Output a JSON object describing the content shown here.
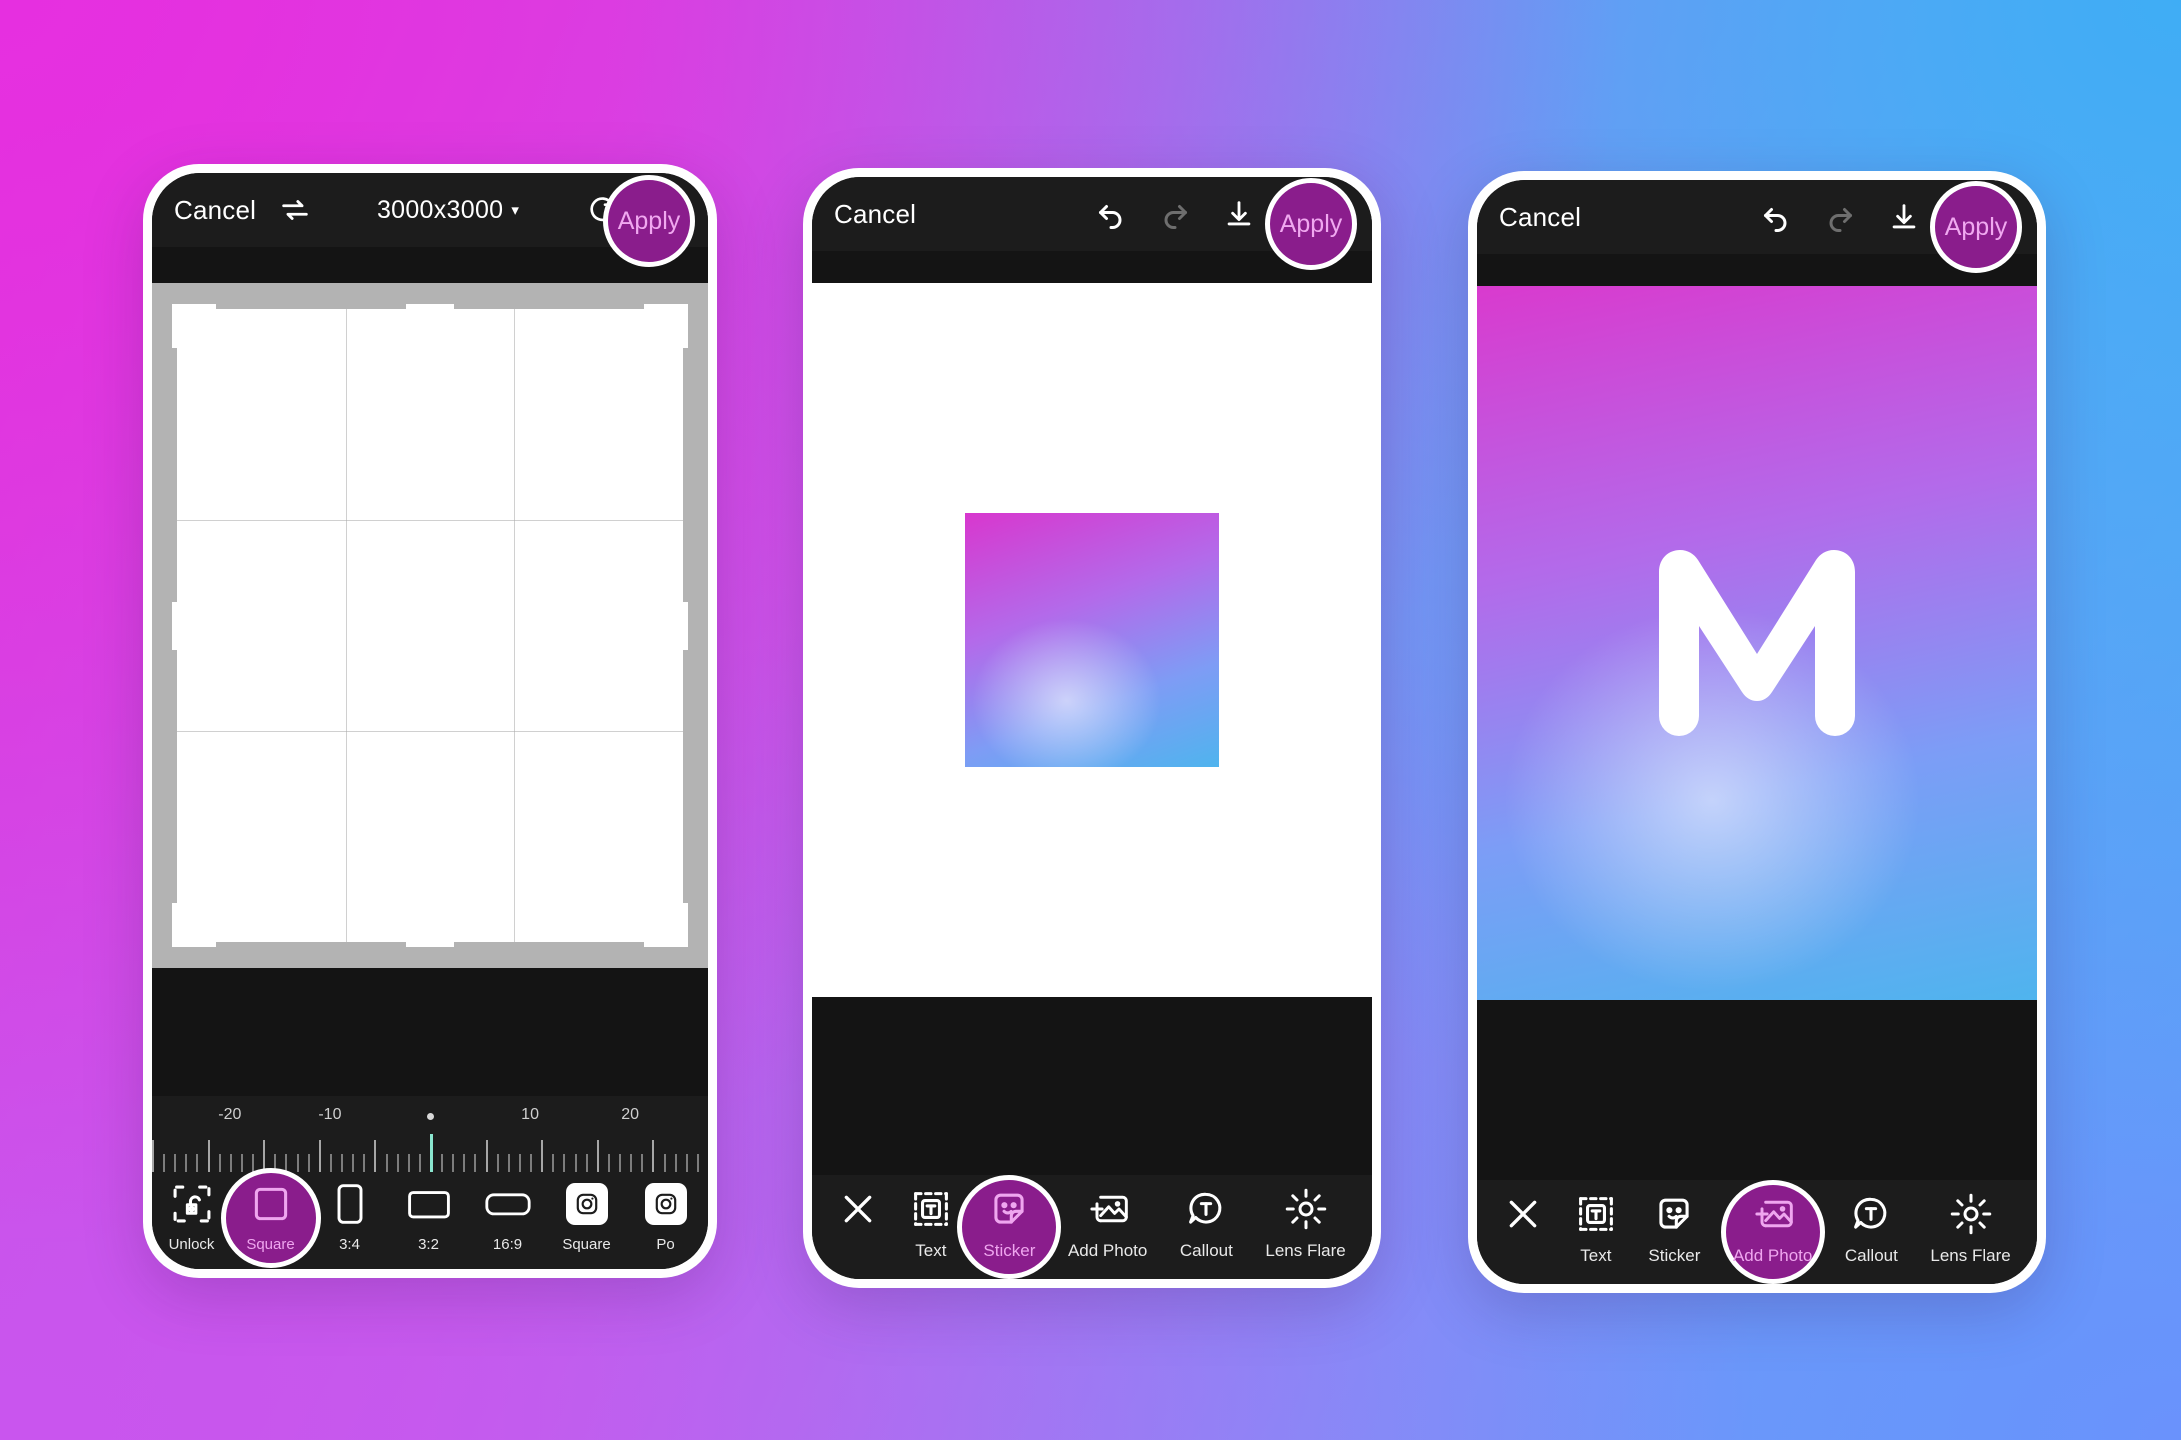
{
  "background": {
    "corner_top_left": "#E62FE0",
    "corner_top_right": "#3FADF5",
    "corner_bottom_left": "#C955EE",
    "corner_bottom_right": "#6A92FC"
  },
  "theme": {
    "accent_magenta": "#8A1D8C",
    "accent_text_pink": "#EFA6EF",
    "bar_dark": "#1C1C1C",
    "canvas_dark": "#141414",
    "needle_teal": "#8AE6CF"
  },
  "phones": [
    {
      "id": "crop-screen",
      "topbar": {
        "cancel_label": "Cancel",
        "flip_icon": "flip-swap-icon",
        "size_label": "3000x3000",
        "size_caret": "▾",
        "rotate_icon": "rotate-icon",
        "apply_label": "Apply"
      },
      "ruler": {
        "labels": [
          {
            "value": "-20",
            "pos_pct": 14
          },
          {
            "value": "-10",
            "pos_pct": 32
          },
          {
            "value": "10",
            "pos_pct": 68
          },
          {
            "value": "20",
            "pos_pct": 86
          }
        ],
        "current_value": 0,
        "range_min": -25,
        "range_max": 25,
        "center_dot": true
      },
      "tools": [
        {
          "label": "Unlock",
          "icon": "unlock-crop-icon",
          "active": false
        },
        {
          "label": "Square",
          "icon": "square-ratio-icon",
          "active": true
        },
        {
          "label": "3:4",
          "icon": "ratio-3-4-icon",
          "active": false
        },
        {
          "label": "3:2",
          "icon": "ratio-3-2-icon",
          "active": false
        },
        {
          "label": "16:9",
          "icon": "ratio-16-9-icon",
          "active": false
        },
        {
          "label": "Square",
          "icon": "instagram-square-icon",
          "active": false
        },
        {
          "label": "Po",
          "icon": "instagram-portrait-icon",
          "active": false
        }
      ]
    },
    {
      "id": "sticker-screen",
      "topbar": {
        "cancel_label": "Cancel",
        "undo_icon": "undo-icon",
        "redo_icon": "redo-icon",
        "download_icon": "download-icon",
        "apply_label": "Apply"
      },
      "canvas": {
        "content": "gradient-square-image"
      },
      "tools": [
        {
          "label": "",
          "icon": "close-x-icon",
          "active": false
        },
        {
          "label": "Text",
          "icon": "text-box-icon",
          "active": false
        },
        {
          "label": "Sticker",
          "icon": "sticker-icon",
          "active": true
        },
        {
          "label": "Add Photo",
          "icon": "add-photo-icon",
          "active": false
        },
        {
          "label": "Callout",
          "icon": "callout-icon",
          "active": false
        },
        {
          "label": "Lens Flare",
          "icon": "lens-flare-icon",
          "active": false
        }
      ]
    },
    {
      "id": "addphoto-screen",
      "topbar": {
        "cancel_label": "Cancel",
        "undo_icon": "undo-icon",
        "redo_icon": "redo-icon",
        "download_icon": "download-icon",
        "apply_label": "Apply"
      },
      "canvas": {
        "content": "m-logo-on-gradient"
      },
      "tools": [
        {
          "label": "",
          "icon": "close-x-icon",
          "active": false
        },
        {
          "label": "Text",
          "icon": "text-box-icon",
          "active": false
        },
        {
          "label": "Sticker",
          "icon": "sticker-icon",
          "active": false
        },
        {
          "label": "Add Photo",
          "icon": "add-photo-icon",
          "active": true
        },
        {
          "label": "Callout",
          "icon": "callout-icon",
          "active": false
        },
        {
          "label": "Lens Flare",
          "icon": "lens-flare-icon",
          "active": false
        }
      ]
    }
  ]
}
